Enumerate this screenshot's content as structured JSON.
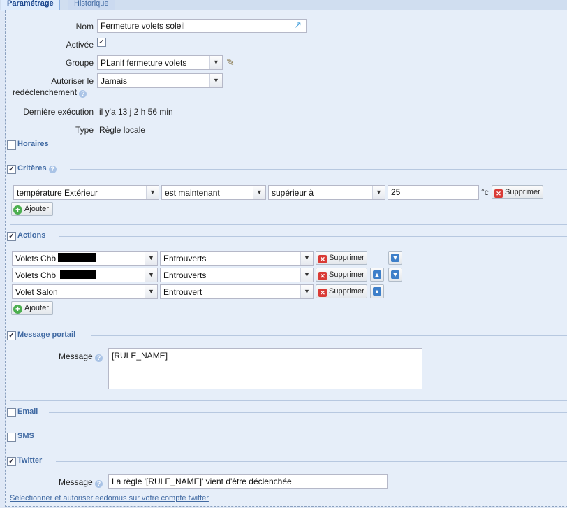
{
  "tabs": [
    {
      "label": "Paramétrage",
      "active": true
    },
    {
      "label": "Historique",
      "active": false
    }
  ],
  "general": {
    "nom_label": "Nom",
    "nom_value": "Fermeture volets soleil",
    "activee_label": "Activée",
    "activee_checked": true,
    "groupe_label": "Groupe",
    "groupe_value": "PLanif fermeture volets",
    "autoriser_label_1": "Autoriser le",
    "autoriser_label_2": "redéclenchement",
    "autoriser_value": "Jamais",
    "derniere_label": "Dernière exécution",
    "derniere_value": "il y'a 13 j 2 h 56 min",
    "type_label": "Type",
    "type_value": "Règle locale"
  },
  "sections": {
    "horaires": {
      "title": "Horaires",
      "checked": false
    },
    "criteres": {
      "title": "Critères",
      "checked": true
    },
    "actions": {
      "title": "Actions",
      "checked": true
    },
    "message_portail": {
      "title": "Message portail",
      "checked": true
    },
    "email": {
      "title": "Email",
      "checked": false
    },
    "sms": {
      "title": "SMS",
      "checked": false
    },
    "twitter": {
      "title": "Twitter",
      "checked": true
    }
  },
  "criteres": {
    "device": "température Extérieur",
    "when": "est maintenant",
    "operator": "supérieur à",
    "value": "25",
    "unit": "°c",
    "delete_label": "Supprimer",
    "add_label": "Ajouter"
  },
  "actions": {
    "rows": [
      {
        "device": "Volets Chb",
        "state": "Entrouverts"
      },
      {
        "device": "Volets Chb",
        "state": "Entrouverts"
      },
      {
        "device": "Volet Salon",
        "state": "Entrouvert"
      }
    ],
    "delete_label": "Supprimer",
    "add_label": "Ajouter"
  },
  "portail": {
    "message_label": "Message",
    "message_value": "[RULE_NAME]"
  },
  "twitter": {
    "message_label": "Message",
    "message_value": "La règle '[RULE_NAME]' vient d'être déclenchée",
    "link": "Sélectionner et autoriser eedomus sur votre compte twitter"
  }
}
